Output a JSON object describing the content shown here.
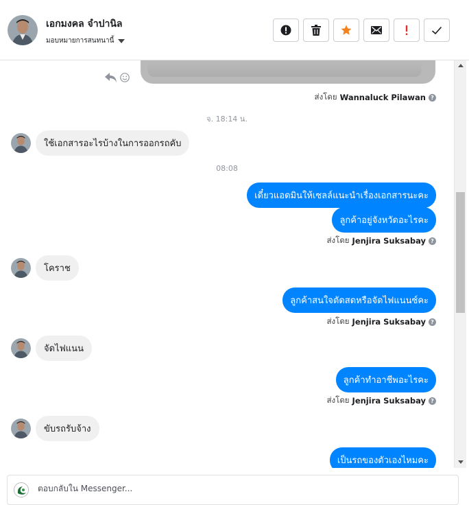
{
  "header": {
    "contact_name": "เอกมงคล จำปานิล",
    "assign_label": "มอบหมายการสนทนานี้",
    "toolbar": [
      {
        "name": "report-button",
        "icon": "exclamation-circle-icon"
      },
      {
        "name": "delete-button",
        "icon": "trash-icon"
      },
      {
        "name": "star-button",
        "icon": "star-icon",
        "color": "#f5821f"
      },
      {
        "name": "mark-unread-button",
        "icon": "envelope-icon"
      },
      {
        "name": "important-button",
        "icon": "exclamation-icon",
        "color": "#e02f2f"
      },
      {
        "name": "done-button",
        "icon": "check-icon"
      }
    ]
  },
  "messages": {
    "sent_by_prefix": "ส่งโดย",
    "first_sender": "Wannaluck Pilawan",
    "ts1": "จ. 18:14 น.",
    "in1": "ใช้เอกสารอะไรบ้างในการออกรถคับ",
    "ts2": "08:08",
    "out1": "เดี๋ยวแอดมินให้เซลล์แนะนำเรื่องเอกสารนะคะ",
    "out2": "ลูกค้าอยู่จังหวัดอะไรคะ",
    "sender2": "Jenjira Suksabay",
    "in2": "โคราช",
    "out3": "ลูกค้าสนใจตัดสดหรือจัดไฟแนนซ์คะ",
    "sender3": "Jenjira Suksabay",
    "in3": "จัดไฟแนน",
    "out4": "ลูกค้าทำอาชีพอะไรคะ",
    "sender4": "Jenjira Suksabay",
    "in4": "ขับรถรับจ้าง",
    "out5": "เป็นรถของตัวเองไหมคะ"
  },
  "composer": {
    "placeholder": "ตอบกลับใน Messenger..."
  },
  "colors": {
    "outgoing_bubble": "#0084ff",
    "incoming_bubble": "#f1f0f0"
  }
}
